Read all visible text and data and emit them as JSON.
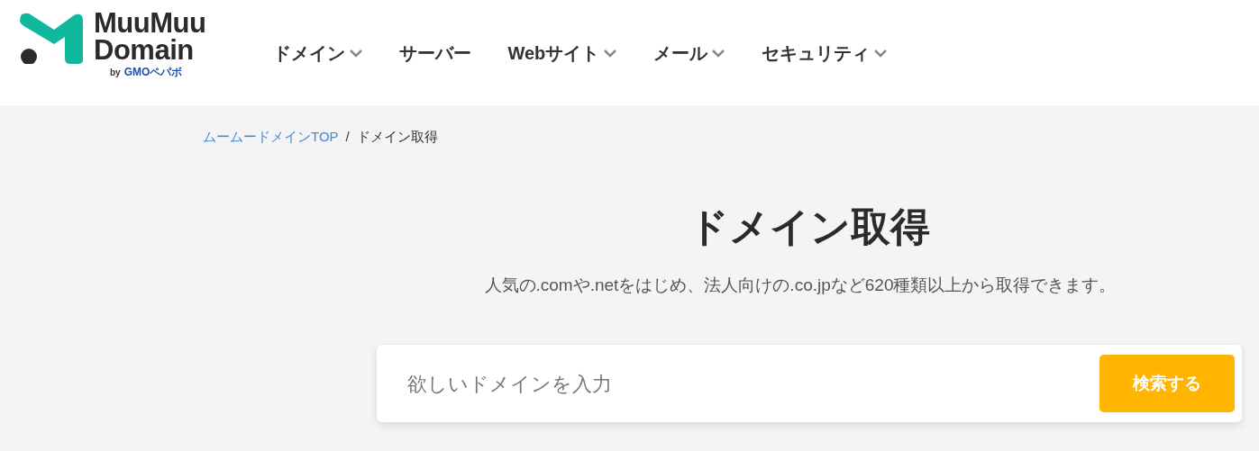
{
  "logo": {
    "line1": "MuuMuu",
    "line2": "Domain",
    "by": "by",
    "company": "GMOペパボ"
  },
  "nav": [
    {
      "label": "ドメイン",
      "has_dropdown": true
    },
    {
      "label": "サーバー",
      "has_dropdown": false
    },
    {
      "label": "Webサイト",
      "has_dropdown": true
    },
    {
      "label": "メール",
      "has_dropdown": true
    },
    {
      "label": "セキュリティ",
      "has_dropdown": true
    }
  ],
  "breadcrumb": [
    {
      "label": "ムームードメインTOP",
      "link": true
    },
    {
      "label": "ドメイン取得",
      "link": false
    }
  ],
  "breadcrumb_separator": "/",
  "title": "ドメイン取得",
  "subtitle": "人気の.comや.netをはじめ、法人向けの.co.jpなど620種類以上から取得できます。",
  "search": {
    "placeholder": "欲しいドメインを入力",
    "button": "検索する"
  }
}
